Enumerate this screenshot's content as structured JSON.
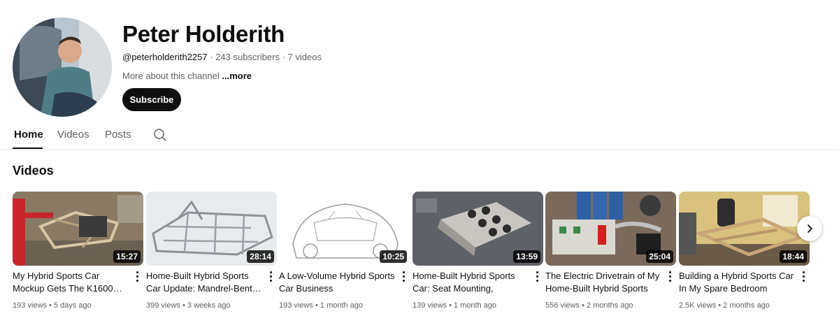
{
  "channel": {
    "name": "Peter Holderith",
    "handle": "@peterholderith2257",
    "subscribers": "243 subscribers",
    "video_count": "7 videos",
    "separator": " · ",
    "about": "More about this channel",
    "more_label": "...more",
    "subscribe_label": "Subscribe"
  },
  "tabs": [
    {
      "label": "Home",
      "active": true
    },
    {
      "label": "Videos",
      "active": false
    },
    {
      "label": "Posts",
      "active": false
    }
  ],
  "section": {
    "title": "Videos"
  },
  "videos": [
    {
      "title": "My Hybrid Sports Car Mockup Gets The K1600…",
      "duration": "15:27",
      "views": "193 views",
      "age": "5 days ago"
    },
    {
      "title": "Home-Built Hybrid Sports Car Update: Mandrel-Bent…",
      "duration": "28:14",
      "views": "399 views",
      "age": "3 weeks ago"
    },
    {
      "title": "A Low-Volume Hybrid Sports Car Business",
      "duration": "10:25",
      "views": "193 views",
      "age": "1 month ago"
    },
    {
      "title": "Home-Built Hybrid Sports Car: Seat Mounting, Battery…",
      "duration": "13:59",
      "views": "139 views",
      "age": "1 month ago"
    },
    {
      "title": "The Electric Drivetrain of My Home-Built Hybrid Sports Car",
      "duration": "25:04",
      "views": "556 views",
      "age": "2 months ago"
    },
    {
      "title": "Building a Hybrid Sports Car In My Spare Bedroom",
      "duration": "18:44",
      "views": "2.5K views",
      "age": "2 months ago"
    }
  ],
  "stats_separator": " • "
}
